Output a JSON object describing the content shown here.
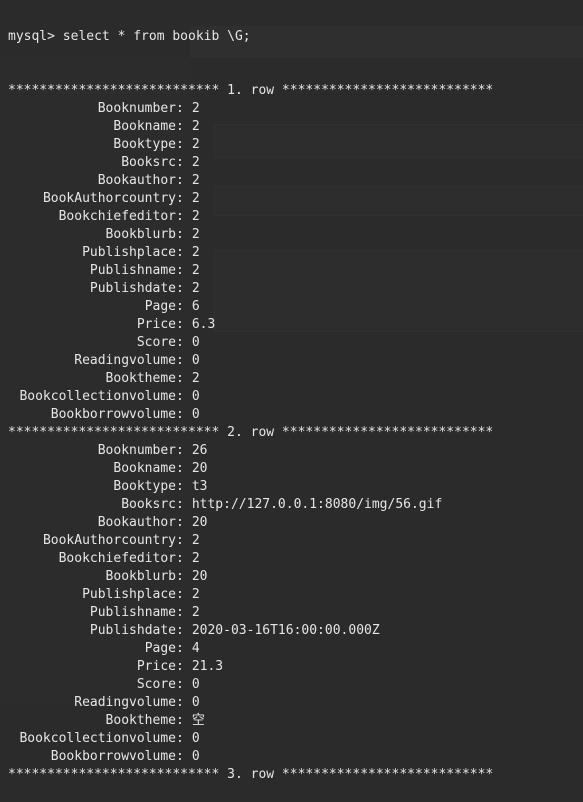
{
  "prompt_line": "mysql> select * from bookib \\G;",
  "rows": [
    {
      "separator": "*************************** 1. row ***************************",
      "fields": [
        {
          "name": "Booknumber",
          "value": "2"
        },
        {
          "name": "Bookname",
          "value": "2"
        },
        {
          "name": "Booktype",
          "value": "2"
        },
        {
          "name": "Booksrc",
          "value": "2"
        },
        {
          "name": "Bookauthor",
          "value": "2"
        },
        {
          "name": "BookAuthorcountry",
          "value": "2"
        },
        {
          "name": "Bookchiefeditor",
          "value": "2"
        },
        {
          "name": "Bookblurb",
          "value": "2"
        },
        {
          "name": "Publishplace",
          "value": "2"
        },
        {
          "name": "Publishname",
          "value": "2"
        },
        {
          "name": "Publishdate",
          "value": "2"
        },
        {
          "name": "Page",
          "value": "6"
        },
        {
          "name": "Price",
          "value": "6.3"
        },
        {
          "name": "Score",
          "value": "0"
        },
        {
          "name": "Readingvolume",
          "value": "0"
        },
        {
          "name": "Booktheme",
          "value": "2"
        },
        {
          "name": "Bookcollectionvolume",
          "value": "0"
        },
        {
          "name": "Bookborrowvolume",
          "value": "0"
        }
      ]
    },
    {
      "separator": "*************************** 2. row ***************************",
      "fields": [
        {
          "name": "Booknumber",
          "value": "26"
        },
        {
          "name": "Bookname",
          "value": "20"
        },
        {
          "name": "Booktype",
          "value": "t3"
        },
        {
          "name": "Booksrc",
          "value": "http://127.0.0.1:8080/img/56.gif"
        },
        {
          "name": "Bookauthor",
          "value": "20"
        },
        {
          "name": "BookAuthorcountry",
          "value": "2"
        },
        {
          "name": "Bookchiefeditor",
          "value": "2"
        },
        {
          "name": "Bookblurb",
          "value": "20"
        },
        {
          "name": "Publishplace",
          "value": "2"
        },
        {
          "name": "Publishname",
          "value": "2"
        },
        {
          "name": "Publishdate",
          "value": "2020-03-16T16:00:00.000Z"
        },
        {
          "name": "Page",
          "value": "4"
        },
        {
          "name": "Price",
          "value": "21.3"
        },
        {
          "name": "Score",
          "value": "0"
        },
        {
          "name": "Readingvolume",
          "value": "0"
        },
        {
          "name": "Booktheme",
          "value": "空"
        },
        {
          "name": "Bookcollectionvolume",
          "value": "0"
        },
        {
          "name": "Bookborrowvolume",
          "value": "0"
        }
      ]
    },
    {
      "separator": "*************************** 3. row ***************************",
      "fields": []
    }
  ]
}
